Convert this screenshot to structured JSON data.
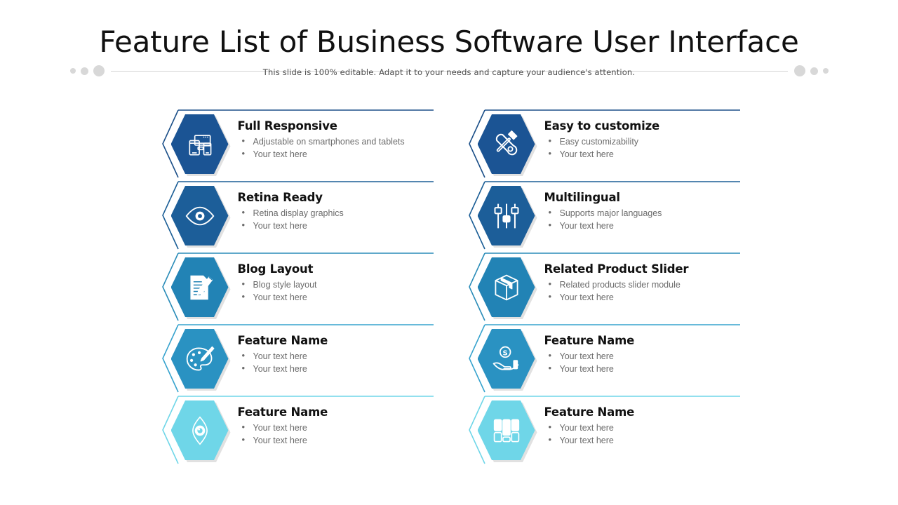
{
  "header": {
    "title": "Feature List of Business Software User Interface",
    "subtitle": "This slide is 100% editable. Adapt it to your needs and capture your audience's attention.",
    "left_dots": [
      "dot-small",
      "dot-medium",
      "dot-large"
    ],
    "right_dots": [
      "dot-large",
      "dot-medium",
      "dot-small"
    ]
  },
  "palette": {
    "navy": "#1B5494",
    "steel": "#1C5E99",
    "teal": "#2283B5",
    "cyan": "#6FD6E8",
    "outline_navy": "#1B4F88",
    "outline_teal": "#2A8CB8",
    "outline_cyan": "#6FD6E8",
    "text_dark": "#111111",
    "text_muted": "#6b6b6b",
    "rule_gray": "#d4d4d4",
    "dot_gray": "#d8d8d8"
  },
  "columns": [
    {
      "name": "left-column",
      "items": [
        {
          "title": "Full Responsive",
          "bullets": [
            "Adjustable on smartphones and tablets",
            "Your text here"
          ],
          "icon": "devices-icon",
          "fill": "#1B5494",
          "outline": "#1B4F88"
        },
        {
          "title": "Retina Ready",
          "bullets": [
            "Retina display graphics",
            "Your text here"
          ],
          "icon": "eye-icon",
          "fill": "#1C5E99",
          "outline": "#1B5E96"
        },
        {
          "title": "Blog Layout",
          "bullets": [
            "Blog style layout",
            "Your text here"
          ],
          "icon": "document-pen-icon",
          "fill": "#2283B5",
          "outline": "#2A8CB8"
        },
        {
          "title": "Feature Name",
          "bullets": [
            "Your text here",
            "Your text here"
          ],
          "icon": "palette-brush-icon",
          "fill": "#2A92C2",
          "outline": "#37A3CE"
        },
        {
          "title": "Feature Name",
          "bullets": [
            "Your text here",
            "Your text here"
          ],
          "icon": "aperture-eye-icon",
          "fill": "#6FD6E8",
          "outline": "#6FD6E8"
        }
      ]
    },
    {
      "name": "right-column",
      "items": [
        {
          "title": "Easy to customize",
          "bullets": [
            "Easy customizability",
            "Your text here"
          ],
          "icon": "tools-icon",
          "fill": "#1B5494",
          "outline": "#1B4F88"
        },
        {
          "title": "Multilingual",
          "bullets": [
            "Supports major languages",
            "Your text here"
          ],
          "icon": "sliders-icon",
          "fill": "#1C5E99",
          "outline": "#1B5E96"
        },
        {
          "title": "Related Product Slider",
          "bullets": [
            "Related products slider module",
            "Your text here"
          ],
          "icon": "box-icon",
          "fill": "#2283B5",
          "outline": "#2A8CB8"
        },
        {
          "title": "Feature Name",
          "bullets": [
            "Your text here",
            "Your text here"
          ],
          "icon": "hand-coin-icon",
          "fill": "#2A92C2",
          "outline": "#37A3CE"
        },
        {
          "title": "Feature Name",
          "bullets": [
            "Your text here",
            "Your text here"
          ],
          "icon": "blocks-grid-icon",
          "fill": "#6FD6E8",
          "outline": "#6FD6E8"
        }
      ]
    }
  ]
}
